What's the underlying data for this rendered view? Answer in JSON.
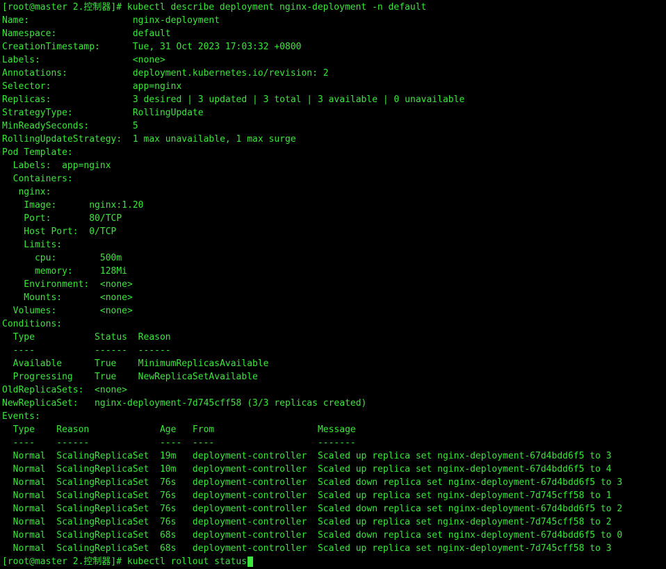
{
  "terminal": {
    "colors": {
      "background": "#000000",
      "text": "#3ce63c"
    },
    "lines": [
      "[root@master 2.控制器]# kubectl describe deployment nginx-deployment -n default",
      "Name:                   nginx-deployment",
      "Namespace:              default",
      "CreationTimestamp:      Tue, 31 Oct 2023 17:03:32 +0800",
      "Labels:                 <none>",
      "Annotations:            deployment.kubernetes.io/revision: 2",
      "Selector:               app=nginx",
      "Replicas:               3 desired | 3 updated | 3 total | 3 available | 0 unavailable",
      "StrategyType:           RollingUpdate",
      "MinReadySeconds:        5",
      "RollingUpdateStrategy:  1 max unavailable, 1 max surge",
      "Pod Template:",
      "  Labels:  app=nginx",
      "  Containers:",
      "   nginx:",
      "    Image:      nginx:1.20",
      "    Port:       80/TCP",
      "    Host Port:  0/TCP",
      "    Limits:",
      "      cpu:        500m",
      "      memory:     128Mi",
      "    Environment:  <none>",
      "    Mounts:       <none>",
      "  Volumes:        <none>",
      "Conditions:",
      "  Type           Status  Reason",
      "  ----           ------  ------",
      "  Available      True    MinimumReplicasAvailable",
      "  Progressing    True    NewReplicaSetAvailable",
      "OldReplicaSets:  <none>",
      "NewReplicaSet:   nginx-deployment-7d745cff58 (3/3 replicas created)",
      "Events:",
      "  Type    Reason             Age   From                   Message",
      "  ----    ------             ----  ----                   -------",
      "  Normal  ScalingReplicaSet  19m   deployment-controller  Scaled up replica set nginx-deployment-67d4bdd6f5 to 3",
      "  Normal  ScalingReplicaSet  10m   deployment-controller  Scaled up replica set nginx-deployment-67d4bdd6f5 to 4",
      "  Normal  ScalingReplicaSet  76s   deployment-controller  Scaled down replica set nginx-deployment-67d4bdd6f5 to 3",
      "  Normal  ScalingReplicaSet  76s   deployment-controller  Scaled up replica set nginx-deployment-7d745cff58 to 1",
      "  Normal  ScalingReplicaSet  76s   deployment-controller  Scaled down replica set nginx-deployment-67d4bdd6f5 to 2",
      "  Normal  ScalingReplicaSet  76s   deployment-controller  Scaled up replica set nginx-deployment-7d745cff58 to 2",
      "  Normal  ScalingReplicaSet  68s   deployment-controller  Scaled down replica set nginx-deployment-67d4bdd6f5 to 0",
      "  Normal  ScalingReplicaSet  68s   deployment-controller  Scaled up replica set nginx-deployment-7d745cff58 to 3"
    ],
    "prompt_line": {
      "prompt": "[root@master 2.控制器]#",
      "command": " kubectl rollout status"
    }
  }
}
